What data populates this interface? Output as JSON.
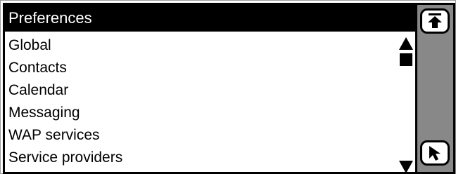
{
  "window": {
    "title": "Preferences"
  },
  "list": {
    "items": [
      {
        "label": "Global"
      },
      {
        "label": "Contacts"
      },
      {
        "label": "Calendar"
      },
      {
        "label": "Messaging"
      },
      {
        "label": "WAP services"
      },
      {
        "label": "Service providers"
      }
    ]
  },
  "scrollbar": {
    "up_icon": "scroll-up-arrow",
    "thumb_icon": "scroll-thumb",
    "down_icon": "scroll-down-arrow"
  },
  "side_buttons": {
    "top_icon": "move-to-top-icon",
    "bottom_icon": "pointer-cursor-icon"
  },
  "colors": {
    "titlebar_bg": "#000000",
    "titlebar_text": "#ffffff",
    "side_panel": "#888888"
  }
}
